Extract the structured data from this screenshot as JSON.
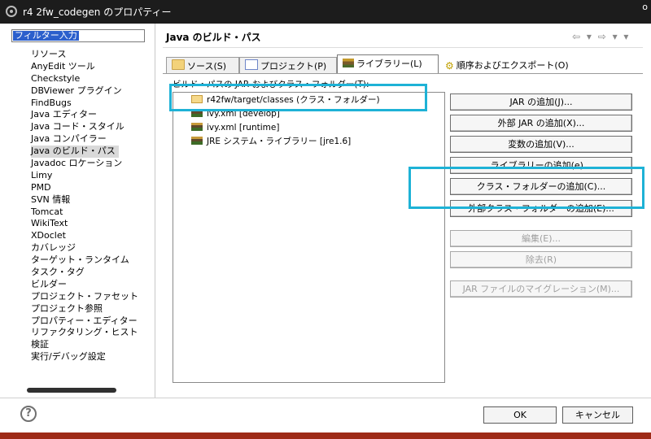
{
  "window": {
    "title": "r4 2fw_codegen のプロパティー",
    "close_glyph": "o"
  },
  "filter": {
    "placeholder": "フィルター入力"
  },
  "nav": {
    "items": [
      "リソース",
      "AnyEdit ツール",
      "Checkstyle",
      "DBViewer プラグイン",
      "FindBugs",
      "Java エディター",
      "Java コード・スタイル",
      "Java コンパイラー",
      "Java のビルド・パス",
      "Javadoc ロケーション",
      "Limy",
      "PMD",
      "SVN 情報",
      "Tomcat",
      "WikiText",
      "XDoclet",
      "カバレッジ",
      "ターゲット・ランタイム",
      "タスク・タグ",
      "ビルダー",
      "プロジェクト・ファセット",
      "プロジェクト参照",
      "プロパティー・エディター",
      "リファクタリング・ヒスト",
      "検証",
      "実行/デバッグ設定"
    ],
    "selected_index": 8
  },
  "header": {
    "title": "Java のビルド・パス",
    "nav_arrows": "⇦ ▾ ⇨ ▾ ▾"
  },
  "tabs": {
    "source": "ソース(S)",
    "projects": "プロジェクト(P)",
    "libraries": "ライブラリー(L)",
    "order": "順序およびエクスポート(O)"
  },
  "path_label": "ビルド・パスの JAR およびクラス・フォルダー(T):",
  "tree": [
    {
      "label": "r42fw/target/classes (クラス・フォルダー)",
      "icon": "folder-icon"
    },
    {
      "label": "ivy.xml [develop]",
      "icon": "jar-icon"
    },
    {
      "label": "ivy.xml [runtime]",
      "icon": "jar-icon"
    },
    {
      "label": "JRE システム・ライブラリー [jre1.6]",
      "icon": "jar-icon"
    }
  ],
  "buttons": {
    "add_jar": "JAR の追加(J)...",
    "add_external_jar": "外部 JAR の追加(X)...",
    "add_variable": "変数の追加(V)...",
    "add_library": "ライブラリーの追加(e)...",
    "add_class_folder": "クラス・フォルダーの追加(C)...",
    "add_external_class_folder": "外部クラス・フォルダーの追加(E)...",
    "edit": "編集(E)...",
    "remove": "除去(R)",
    "migrate_jar": "JAR ファイルのマイグレーション(M)..."
  },
  "footer": {
    "ok": "OK",
    "cancel": "キャンセル",
    "help": "?"
  },
  "colors": {
    "highlight": "#1eb2d6",
    "titlebar": "#1c1c1c",
    "footer_bar": "#9e2a17"
  }
}
